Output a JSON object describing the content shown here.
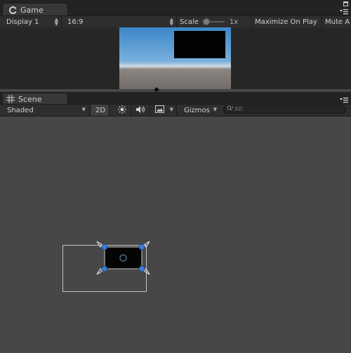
{
  "game": {
    "tab_label": "Game",
    "toolbar": {
      "display": "Display 1",
      "aspect": "16:9",
      "scale_label": "Scale",
      "scale_value": "1x",
      "maximize": "Maximize On Play",
      "mute": "Mute A"
    }
  },
  "scene": {
    "tab_label": "Scene",
    "toolbar": {
      "shading": "Shaded",
      "mode_2d": "2D",
      "gizmos": "Gizmos",
      "search_placeholder": "All"
    }
  },
  "colors": {
    "panel_bg": "#474747",
    "toolbar_bg": "#2e2e2e",
    "tab_bg": "#383838",
    "handle_blue": "#3b7ed8"
  },
  "icons": [
    "game-icon",
    "scene-grid-icon",
    "lighting-icon",
    "audio-icon",
    "effects-icon",
    "search-icon",
    "tab-menu-icon",
    "maximize-icon"
  ]
}
